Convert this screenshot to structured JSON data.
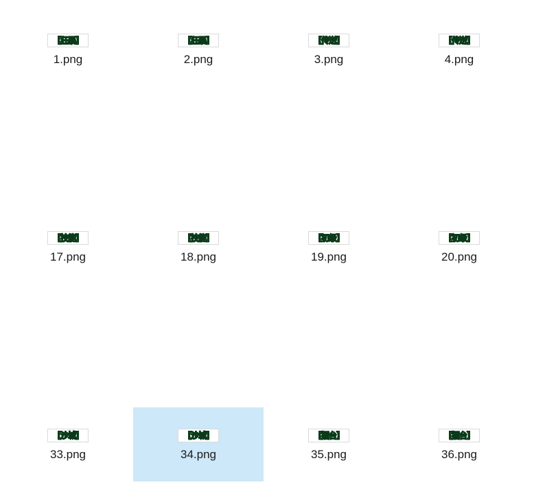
{
  "files": [
    {
      "filename": "1.png",
      "label": "【狂暴】",
      "selected": false
    },
    {
      "filename": "2.png",
      "label": "【狂暴】",
      "selected": false
    },
    {
      "filename": "3.png",
      "label": "【传送】",
      "selected": false
    },
    {
      "filename": "4.png",
      "label": "【传送】",
      "selected": false
    },
    {
      "filename": "17.png",
      "label": "【技能】",
      "selected": false
    },
    {
      "filename": "18.png",
      "label": "【技能】",
      "selected": false
    },
    {
      "filename": "19.png",
      "label": "【初级】",
      "selected": false
    },
    {
      "filename": "20.png",
      "label": "【初级】",
      "selected": false
    },
    {
      "filename": "33.png",
      "label": "【沙城】",
      "selected": false
    },
    {
      "filename": "34.png",
      "label": "【沙城】",
      "selected": true
    },
    {
      "filename": "35.png",
      "label": "【擂台】",
      "selected": false
    },
    {
      "filename": "36.png",
      "label": "【擂台】",
      "selected": false
    }
  ]
}
